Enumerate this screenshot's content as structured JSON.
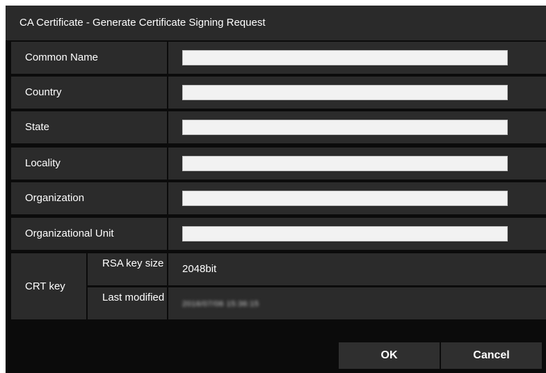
{
  "dialog": {
    "title": "CA Certificate - Generate Certificate Signing Request"
  },
  "fields": [
    {
      "label": "Common Name",
      "value": "",
      "placeholder": ""
    },
    {
      "label": "Country",
      "value": "",
      "placeholder": ""
    },
    {
      "label": "State",
      "value": "",
      "placeholder": ""
    },
    {
      "label": "Locality",
      "value": "",
      "placeholder": ""
    },
    {
      "label": "Organization",
      "value": "",
      "placeholder": ""
    },
    {
      "label": "Organizational Unit",
      "value": "",
      "placeholder": ""
    }
  ],
  "crt_key": {
    "label": "CRT key",
    "rsa_key_size_label": "RSA key size",
    "rsa_key_size_value": "2048bit",
    "last_modified_label": "Last modified",
    "last_modified_value": "2016/07/06 15:36:15"
  },
  "buttons": {
    "ok": "OK",
    "cancel": "Cancel"
  },
  "colors": {
    "background": "#0b0b0b",
    "panel": "#2b2b2b",
    "title_bar": "#2a2a2a",
    "input": "#f2f2f2",
    "text": "#ffffff"
  }
}
